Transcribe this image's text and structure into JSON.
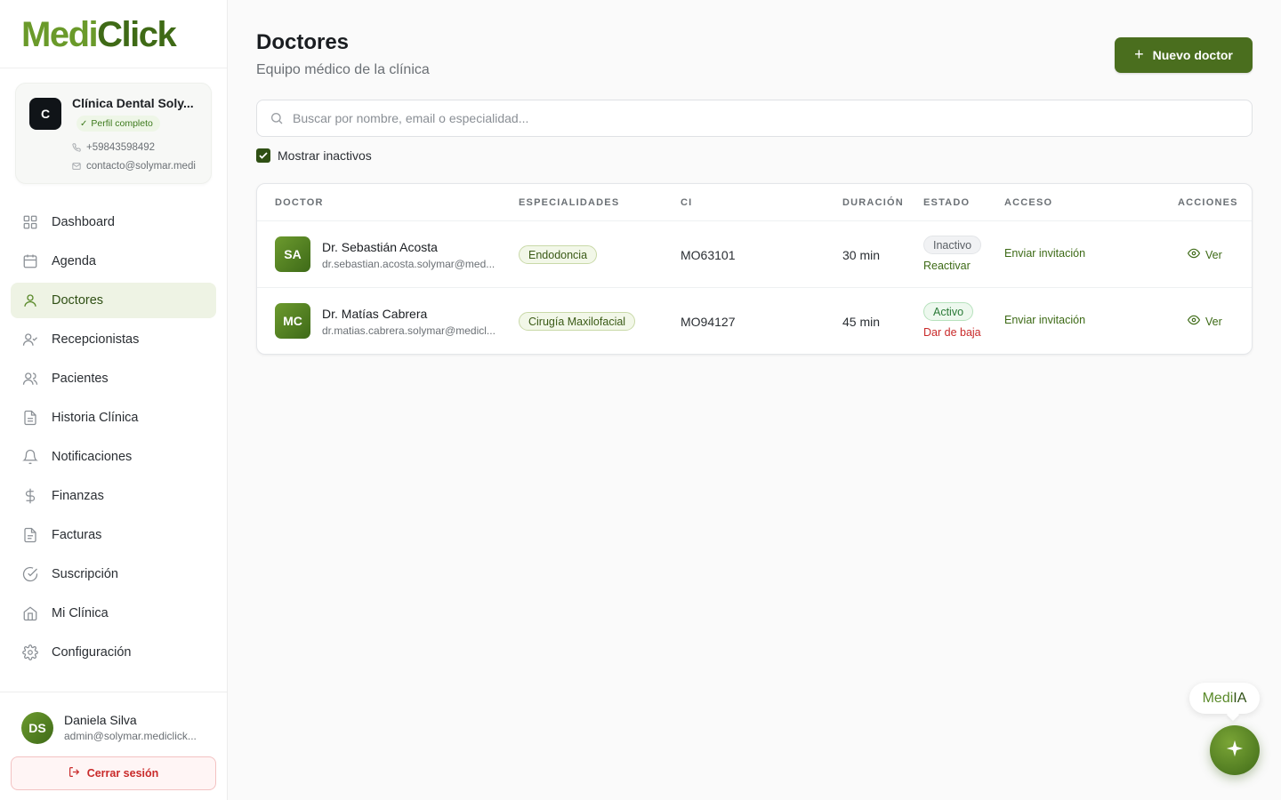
{
  "brand": {
    "name_part1": "Medi",
    "name_part2": "Click",
    "colors": {
      "primary": "#4a6e1e",
      "accent": "#6a9a2a",
      "danger": "#c92a2a"
    }
  },
  "clinic": {
    "initial": "C",
    "name": "Clínica Dental Soly...",
    "badge": "Perfil completo",
    "phone": "+59843598492",
    "email": "contacto@solymar.medi"
  },
  "nav": [
    {
      "label": "Dashboard",
      "icon": "dashboard-icon"
    },
    {
      "label": "Agenda",
      "icon": "calendar-icon"
    },
    {
      "label": "Doctores",
      "icon": "user-icon",
      "active": true
    },
    {
      "label": "Recepcionistas",
      "icon": "user-check-icon"
    },
    {
      "label": "Pacientes",
      "icon": "users-icon"
    },
    {
      "label": "Historia Clínica",
      "icon": "file-icon"
    },
    {
      "label": "Notificaciones",
      "icon": "bell-icon"
    },
    {
      "label": "Finanzas",
      "icon": "dollar-icon"
    },
    {
      "label": "Facturas",
      "icon": "invoice-icon"
    },
    {
      "label": "Suscripción",
      "icon": "check-circle-icon"
    },
    {
      "label": "Mi Clínica",
      "icon": "home-icon"
    },
    {
      "label": "Configuración",
      "icon": "gear-icon"
    }
  ],
  "user": {
    "initials": "DS",
    "name": "Daniela Silva",
    "email": "admin@solymar.mediclick...",
    "logout": "Cerrar sesión"
  },
  "page": {
    "title": "Doctores",
    "subtitle": "Equipo médico de la clínica",
    "new_button": "Nuevo doctor",
    "search_placeholder": "Buscar por nombre, email o especialidad...",
    "show_inactive": "Mostrar inactivos"
  },
  "table": {
    "headers": {
      "doctor": "DOCTOR",
      "specialties": "ESPECIALIDADES",
      "ci": "CI",
      "duration": "DURACIÓN",
      "status": "ESTADO",
      "access": "ACCESO",
      "actions": "ACCIONES"
    },
    "rows": [
      {
        "initials": "SA",
        "name": "Dr. Sebastián Acosta",
        "email": "dr.sebastian.acosta.solymar@med...",
        "specialty": "Endodoncia",
        "ci": "MO63101",
        "duration": "30 min",
        "status": "Inactivo",
        "status_action": "Reactivar",
        "access": "Enviar invitación",
        "view": "Ver"
      },
      {
        "initials": "MC",
        "name": "Dr. Matías Cabrera",
        "email": "dr.matias.cabrera.solymar@medicl...",
        "specialty": "Cirugía Maxilofacial",
        "ci": "MO94127",
        "duration": "45 min",
        "status": "Activo",
        "status_action": "Dar de baja",
        "access": "Enviar invitación",
        "view": "Ver"
      }
    ]
  },
  "assistant": {
    "label_part1": "Medi",
    "label_part2": "IA"
  }
}
